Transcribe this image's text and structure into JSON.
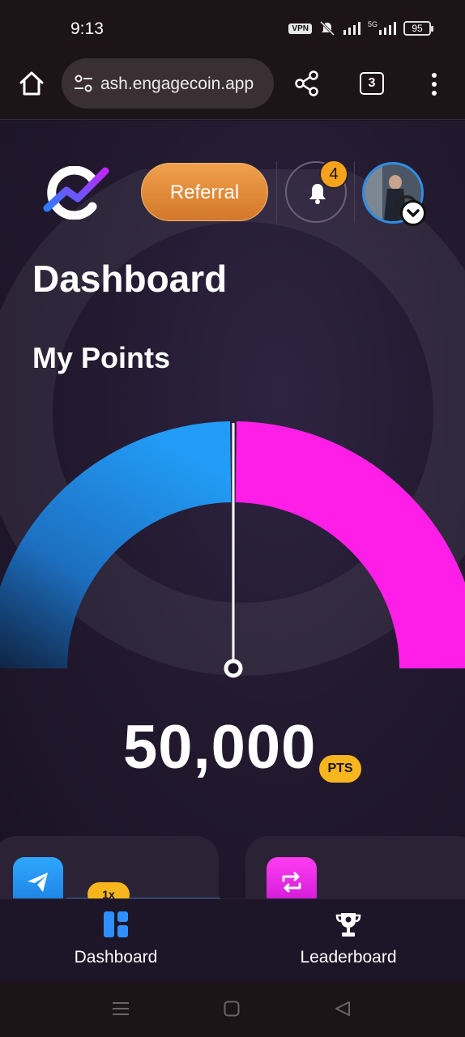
{
  "status_bar": {
    "time": "9:13",
    "vpn": "VPN",
    "network": "5G",
    "battery": "95"
  },
  "browser": {
    "url": "ash.engagecoin.app",
    "tab_count": "3"
  },
  "header": {
    "referral_label": "Referral",
    "notification_count": "4"
  },
  "page": {
    "title": "Dashboard",
    "subtitle": "My Points"
  },
  "points": {
    "value": "50,000",
    "unit": "PTS"
  },
  "gauge": {
    "left_color": "#2196f3",
    "right_color": "#ff1ee8",
    "needle_position": 0.5
  },
  "cards": {
    "left_multiplier": "1x"
  },
  "bottom_nav": {
    "items": [
      {
        "label": "Dashboard",
        "icon": "dashboard-icon",
        "color": "#2f8fff"
      },
      {
        "label": "Leaderboard",
        "icon": "trophy-icon",
        "color": "#ffffff"
      }
    ]
  }
}
